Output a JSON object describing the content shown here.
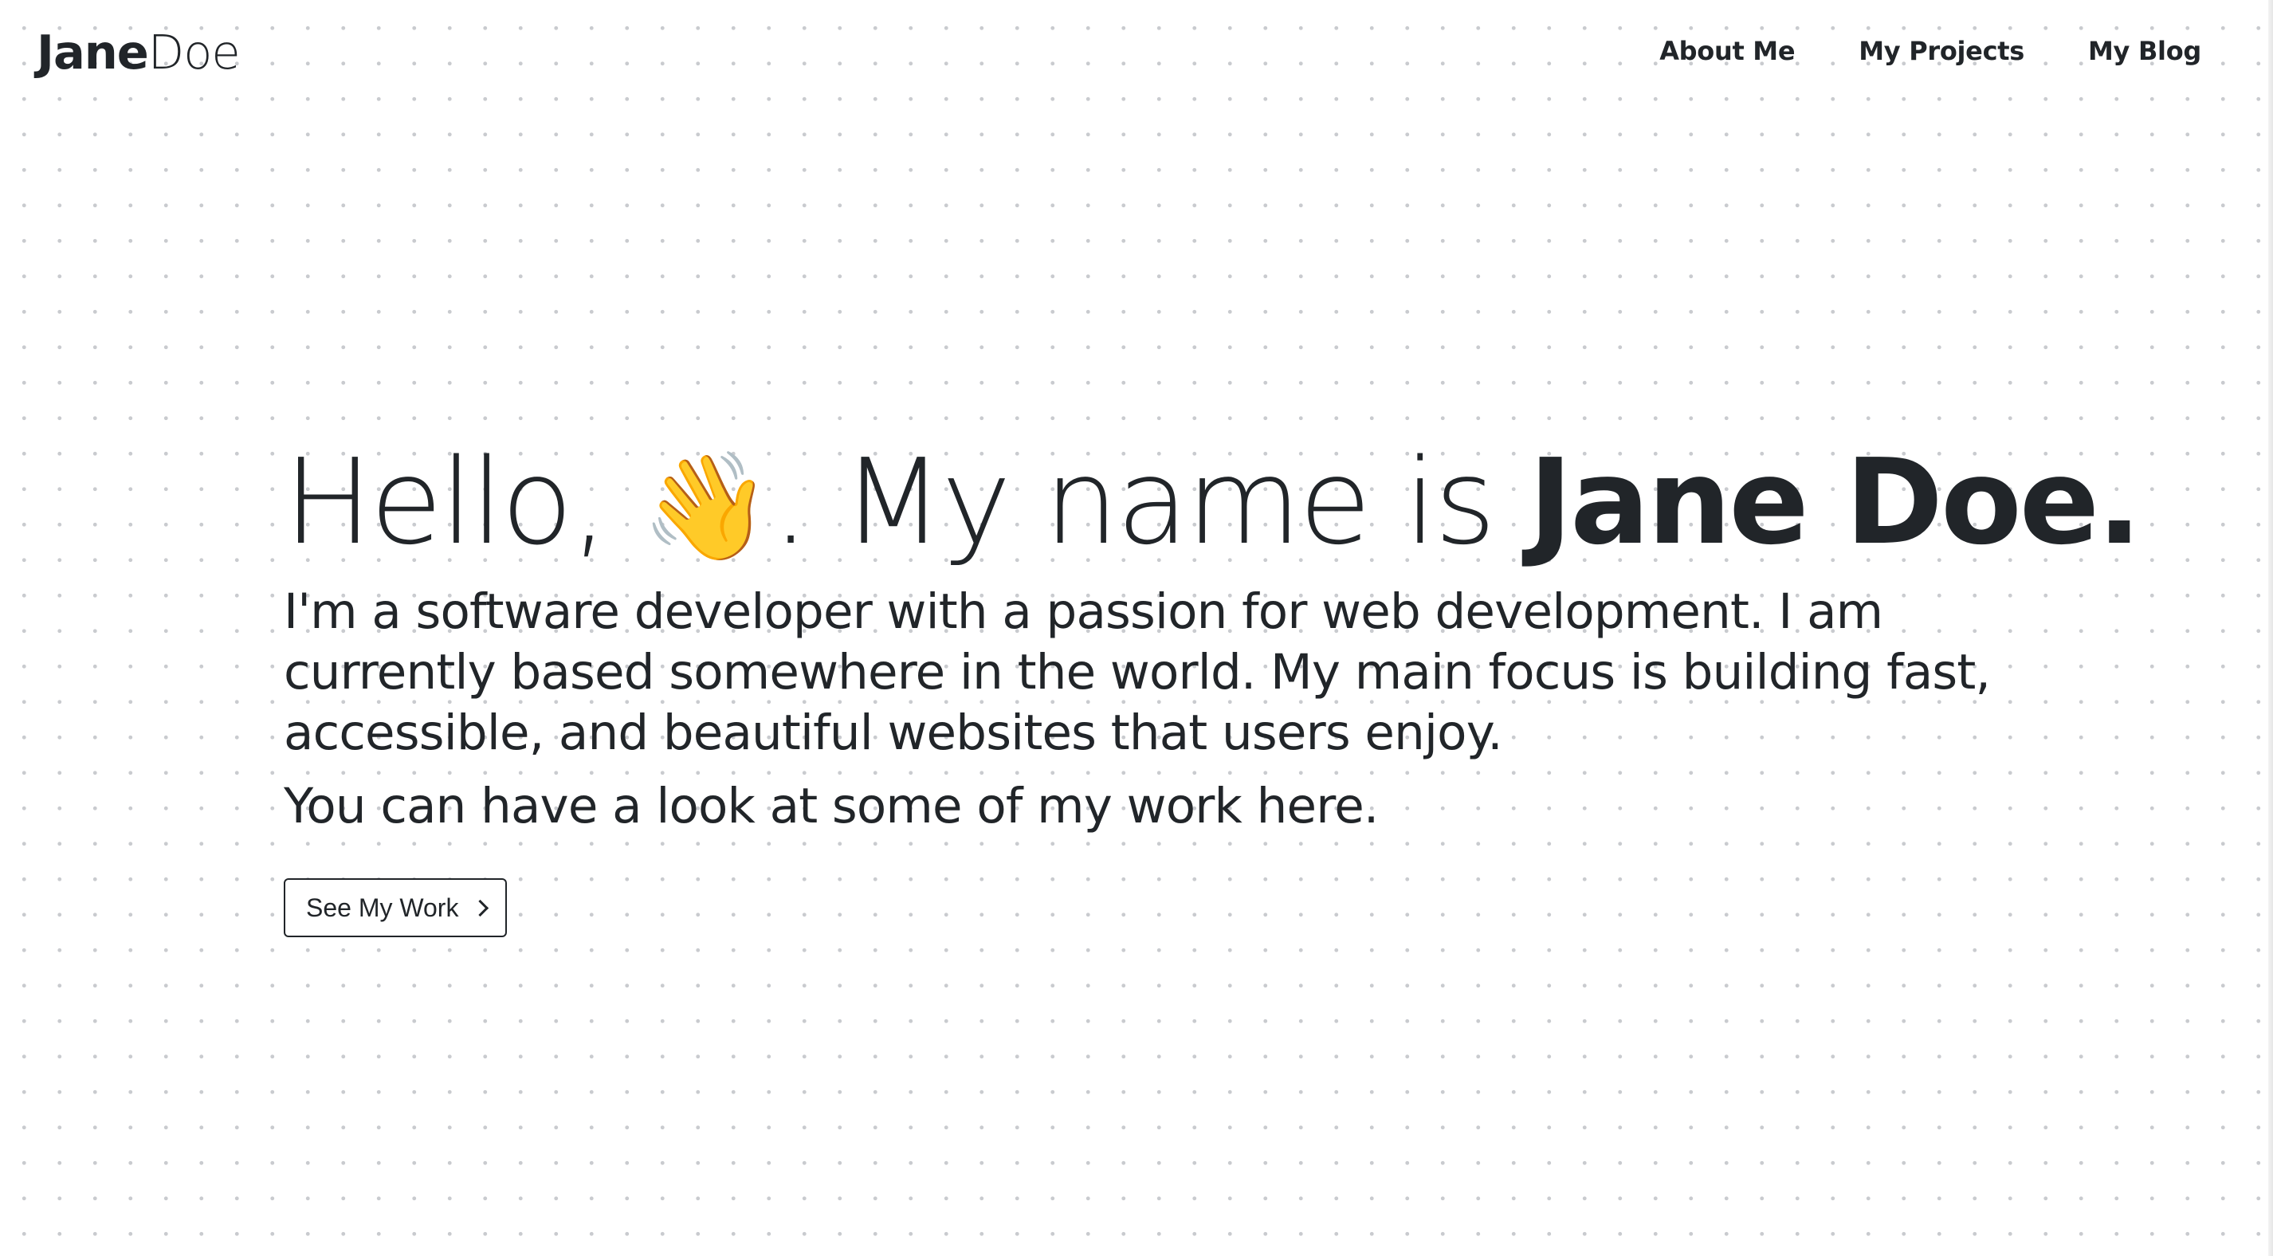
{
  "header": {
    "brand_first": "Jane",
    "brand_last": "Doe",
    "nav": [
      {
        "label": "About Me"
      },
      {
        "label": "My Projects"
      },
      {
        "label": "My Blog"
      }
    ]
  },
  "hero": {
    "title_prefix": "Hello, ",
    "wave_emoji": "👋",
    "title_middle": ". My name is ",
    "title_name": "Jane Doe.",
    "intro": "I'm a software developer with a passion for web development. I am currently based somewhere in the world. My main focus is building fast, accessible, and beautiful websites that users enjoy.",
    "cta_text": "You can have a look at some of my work here.",
    "button_label": "See My Work",
    "button_icon": "chevron-right-icon"
  }
}
